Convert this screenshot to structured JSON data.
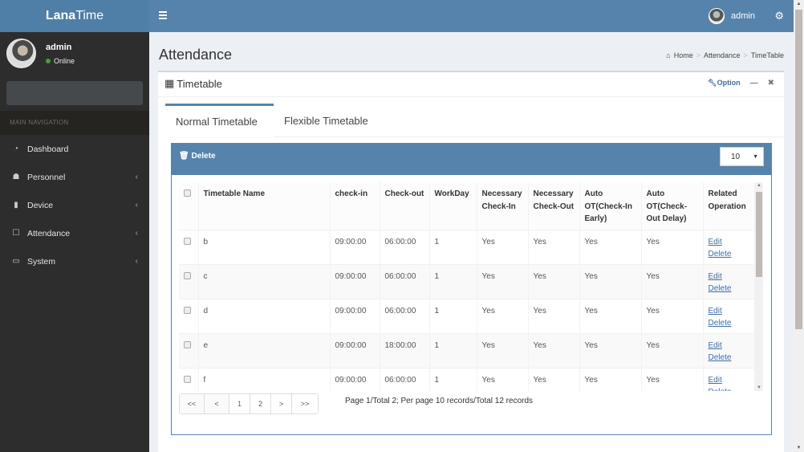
{
  "app": {
    "logo_bold": "Lana",
    "logo_rest": "Time"
  },
  "topbar": {
    "username": "admin",
    "menu_icon": "hamburger-icon",
    "settings_icon": "gears-icon"
  },
  "sidebar": {
    "user": {
      "name": "admin",
      "status": "Online",
      "status_color": "#4d9a3a"
    },
    "nav_header": "MAIN NAVIGATION",
    "items": [
      {
        "label": "Dashboard",
        "icon": "dashboard-icon",
        "glyph": "◔",
        "has_children": false
      },
      {
        "label": "Personnel",
        "icon": "users-icon",
        "glyph": "☗",
        "has_children": true
      },
      {
        "label": "Device",
        "icon": "device-icon",
        "glyph": "▮",
        "has_children": true
      },
      {
        "label": "Attendance",
        "icon": "attendance-icon",
        "glyph": "☐",
        "has_children": true
      },
      {
        "label": "System",
        "icon": "laptop-icon",
        "glyph": "▭",
        "has_children": true
      }
    ],
    "chevron": "‹"
  },
  "page": {
    "title": "Attendance",
    "breadcrumb": [
      "Home",
      "Attendance",
      "TimeTable"
    ],
    "breadcrumb_sep": ">"
  },
  "box": {
    "title": "Timetable",
    "option_label": "Option",
    "minimize": "—",
    "close": "✖"
  },
  "tabs": [
    {
      "label": "Normal Timetable",
      "active": true
    },
    {
      "label": "Flexible Timetable",
      "active": false
    }
  ],
  "toolbar": {
    "delete_label": "Delete",
    "per_page": "10"
  },
  "table": {
    "columns": [
      "Timetable Name",
      "check-in",
      "Check-out",
      "WorkDay",
      "Necessary Check-In",
      "Necessary Check-Out",
      "Auto OT(Check-In Early)",
      "Auto OT(Check-Out Delay)",
      "Related Operation"
    ],
    "rows": [
      {
        "name": "b",
        "checkin": "09:00:00",
        "checkout": "06:00:00",
        "workday": "1",
        "nci": "Yes",
        "nco": "Yes",
        "ote": "Yes",
        "otd": "Yes"
      },
      {
        "name": "c",
        "checkin": "09:00:00",
        "checkout": "06:00:00",
        "workday": "1",
        "nci": "Yes",
        "nco": "Yes",
        "ote": "Yes",
        "otd": "Yes"
      },
      {
        "name": "d",
        "checkin": "09:00:00",
        "checkout": "06:00:00",
        "workday": "1",
        "nci": "Yes",
        "nco": "Yes",
        "ote": "Yes",
        "otd": "Yes"
      },
      {
        "name": "e",
        "checkin": "09:00:00",
        "checkout": "18:00:00",
        "workday": "1",
        "nci": "Yes",
        "nco": "Yes",
        "ote": "Yes",
        "otd": "Yes"
      },
      {
        "name": "f",
        "checkin": "09:00:00",
        "checkout": "06:00:00",
        "workday": "1",
        "nci": "Yes",
        "nco": "Yes",
        "ote": "Yes",
        "otd": "Yes"
      }
    ],
    "edit_label": "Edit",
    "delete_label": "Delete"
  },
  "pagination": {
    "buttons": [
      "<<",
      "<",
      "1",
      "2",
      ">",
      ">>"
    ],
    "current": "1",
    "info": "Page 1/Total 2; Per page 10 records/Total 12 records"
  }
}
